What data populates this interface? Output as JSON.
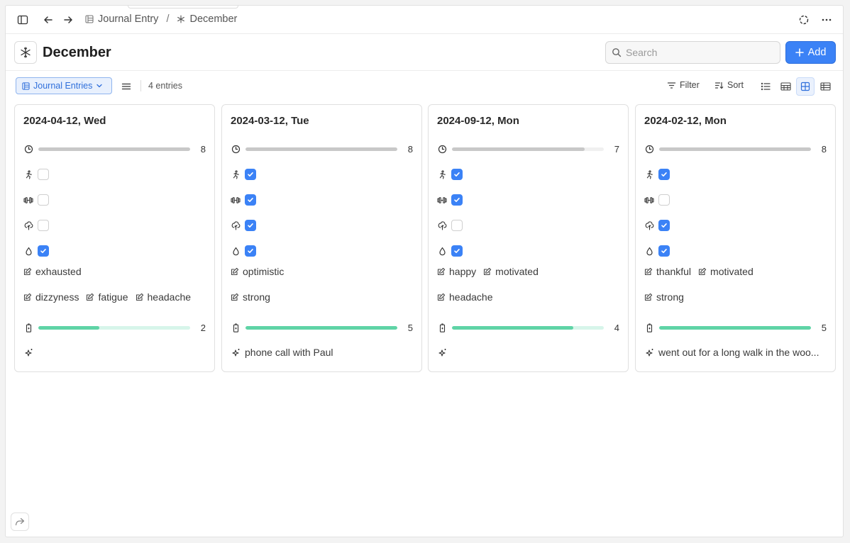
{
  "breadcrumb": {
    "parent": "Journal Entry",
    "separator": "/",
    "current": "December"
  },
  "page": {
    "title": "December",
    "icon": "snowflake-icon"
  },
  "search": {
    "placeholder": "Search",
    "value": ""
  },
  "add_button": {
    "label": "Add"
  },
  "toolbar": {
    "view_label": "Journal Entries",
    "count": "4 entries",
    "filter_label": "Filter",
    "sort_label": "Sort",
    "active_view": "gallery"
  },
  "colors": {
    "accent": "#3b82f6",
    "progress_gray": "#c8c8c8",
    "progress_green": "#5fd4a6"
  },
  "cards": [
    {
      "date": "2024-04-12, Wed",
      "sleep": 8,
      "sleep_fraction": 1.0,
      "checks": [
        false,
        false,
        false,
        true
      ],
      "mood_tags": [
        "exhausted"
      ],
      "symptom_tags": [
        "dizzyness",
        "fatigue",
        "headache"
      ],
      "energy": 2,
      "energy_fraction": 0.4,
      "note": ""
    },
    {
      "date": "2024-03-12, Tue",
      "sleep": 8,
      "sleep_fraction": 1.0,
      "checks": [
        true,
        true,
        true,
        true
      ],
      "mood_tags": [
        "optimistic"
      ],
      "symptom_tags": [
        "strong"
      ],
      "energy": 5,
      "energy_fraction": 1.0,
      "note": "phone call with Paul"
    },
    {
      "date": "2024-09-12, Mon",
      "sleep": 7,
      "sleep_fraction": 0.875,
      "checks": [
        true,
        true,
        false,
        true
      ],
      "mood_tags": [
        "happy",
        "motivated"
      ],
      "symptom_tags": [
        "headache"
      ],
      "energy": 4,
      "energy_fraction": 0.8,
      "note": ""
    },
    {
      "date": "2024-02-12, Mon",
      "sleep": 8,
      "sleep_fraction": 1.0,
      "checks": [
        true,
        false,
        true,
        true
      ],
      "mood_tags": [
        "thankful",
        "motivated"
      ],
      "symptom_tags": [
        "strong"
      ],
      "energy": 5,
      "energy_fraction": 1.0,
      "note": "went out for a long walk in the woo..."
    }
  ]
}
